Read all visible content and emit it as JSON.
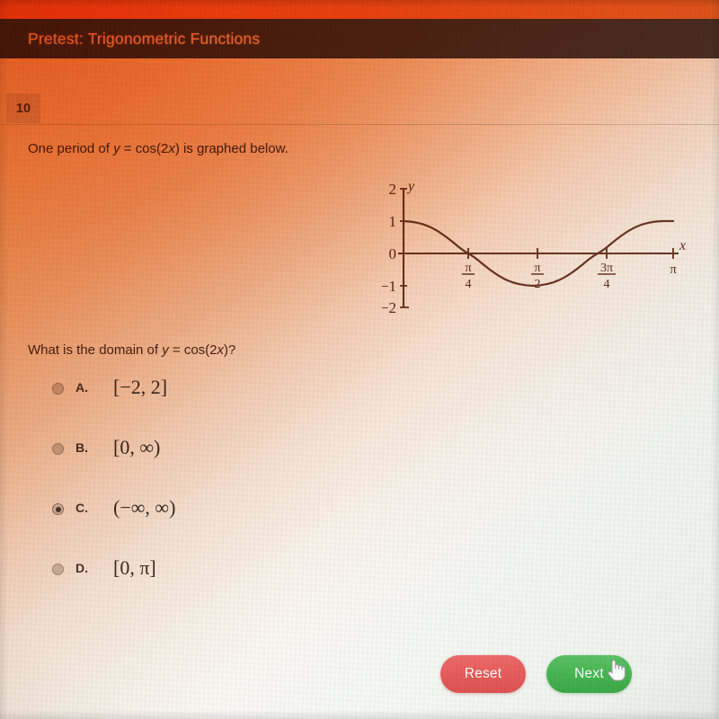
{
  "header": {
    "title": "Pretest: Trigonometric Functions"
  },
  "question_number": "10",
  "prompt": {
    "before": "One period of ",
    "var_y": "y",
    "equals": " = cos(2",
    "var_x": "x",
    "after": ") is graphed below."
  },
  "question": {
    "before": "What is the domain of ",
    "var_y": "y",
    "equals": " = cos(2",
    "var_x": "x",
    "after": ")?"
  },
  "options": [
    {
      "letter": "A.",
      "value": "[−2, 2]",
      "selected": false
    },
    {
      "letter": "B.",
      "value": "[0, ∞)",
      "selected": false
    },
    {
      "letter": "C.",
      "value": "(−∞, ∞)",
      "selected": true
    },
    {
      "letter": "D.",
      "value": "[0, π]",
      "selected": false
    }
  ],
  "buttons": {
    "reset": "Reset",
    "next": "Next"
  },
  "cursor": "hand-pointer-cursor",
  "colors": {
    "header_bar": "#4a3832",
    "header_text": "#f4ddcb",
    "orange_cast": "#f4782d",
    "reset_button": "#e95b5b",
    "next_button": "#46b552",
    "graph_ink": "#6b3a26"
  },
  "chart_data": {
    "type": "line",
    "title": "",
    "function": "y = cos(2x)",
    "xlabel": "x",
    "ylabel": "y",
    "xlim": [
      0,
      3.14159
    ],
    "ylim": [
      -2,
      2
    ],
    "grid": false,
    "legend": "none",
    "y_ticks": [
      2,
      1,
      0,
      -1,
      -2
    ],
    "y_tick_labels": [
      "2",
      "1",
      "0",
      "−1",
      "−2"
    ],
    "x_ticks": [
      0.7854,
      1.5708,
      2.3562,
      3.14159
    ],
    "x_tick_labels": [
      "π/4",
      "π/2",
      "3π/4",
      "π"
    ],
    "series": [
      {
        "name": "y = cos(2x)",
        "x": [
          0,
          0.19635,
          0.3927,
          0.58905,
          0.7854,
          0.98175,
          1.1781,
          1.37445,
          1.5708,
          1.76715,
          1.9635,
          2.15985,
          2.3562,
          2.55255,
          2.7489,
          2.94525,
          3.14159
        ],
        "y": [
          1.0,
          0.9239,
          0.7071,
          0.3827,
          0.0,
          -0.3827,
          -0.7071,
          -0.9239,
          -1.0,
          -0.9239,
          -0.7071,
          -0.3827,
          0.0,
          0.3827,
          0.7071,
          0.9239,
          1.0
        ]
      }
    ]
  }
}
